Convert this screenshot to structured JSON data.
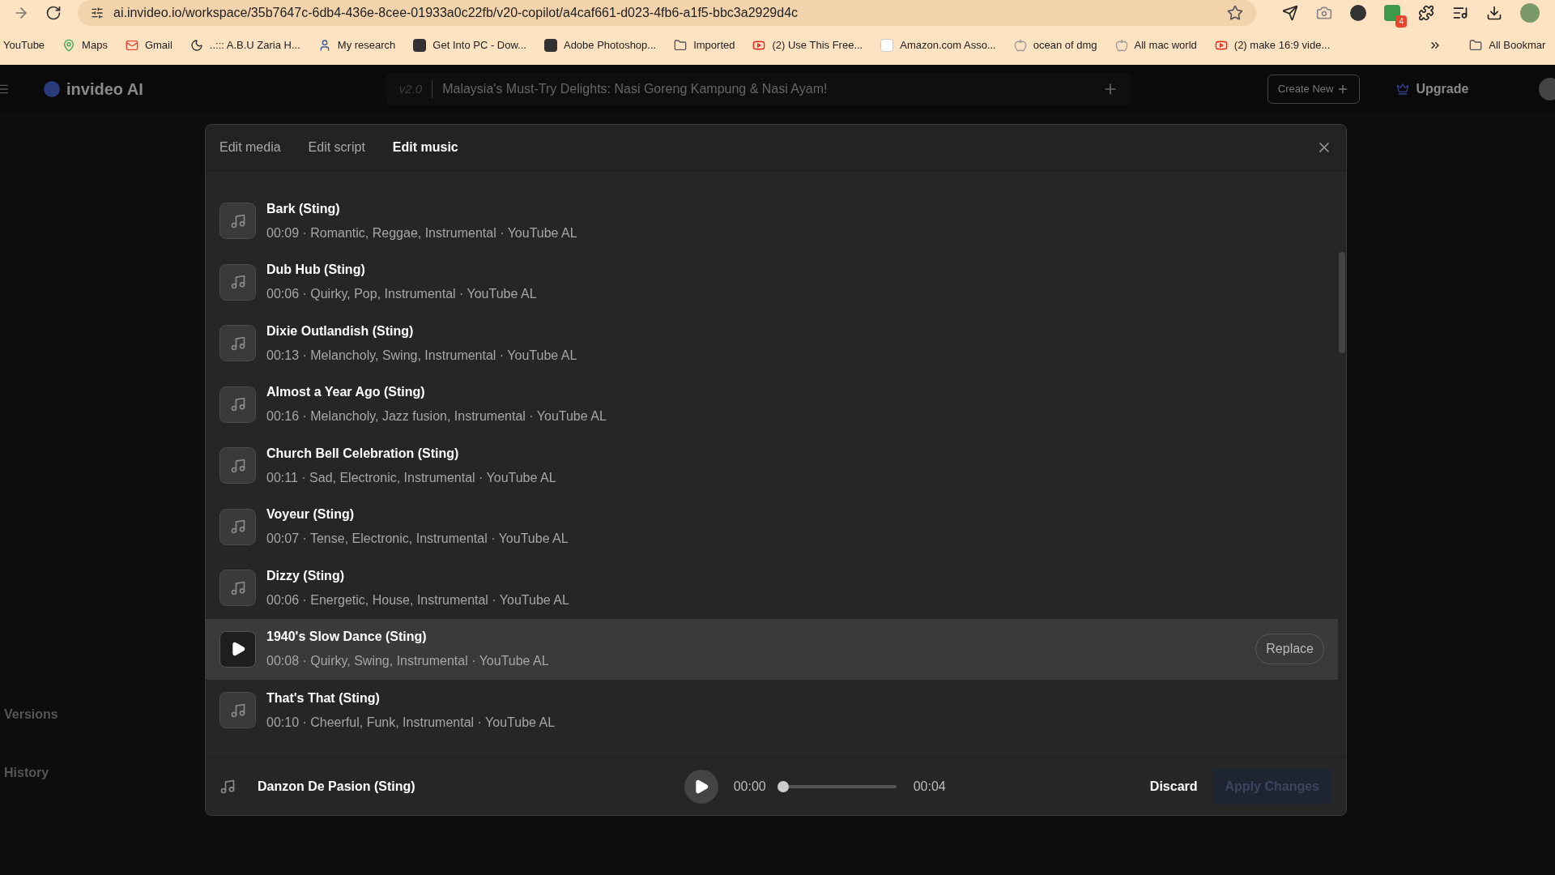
{
  "browser": {
    "url": "ai.invideo.io/workspace/35b7647c-6db4-436e-8cee-01933a0c22fb/v20-copilot/a4caf661-d023-4fb6-a1f5-bbc3a2929d4c",
    "extension_badge": "4",
    "bookmarks": [
      {
        "label": "YouTube",
        "kind": "none"
      },
      {
        "label": "Maps",
        "kind": "pin"
      },
      {
        "label": "Gmail",
        "kind": "mail"
      },
      {
        "label": "..::: A.B.U Zaria H...",
        "kind": "moon"
      },
      {
        "label": "My research",
        "kind": "person"
      },
      {
        "label": "Get Into PC - Dow...",
        "kind": "square"
      },
      {
        "label": "Adobe Photoshop...",
        "kind": "square"
      },
      {
        "label": "Imported",
        "kind": "folder"
      },
      {
        "label": "(2) Use This Free...",
        "kind": "video"
      },
      {
        "label": "Amazon.com Asso...",
        "kind": "letter"
      },
      {
        "label": "ocean of dmg",
        "kind": "apple"
      },
      {
        "label": "All mac world",
        "kind": "apple"
      },
      {
        "label": "(2) make 16:9 vide...",
        "kind": "video"
      }
    ],
    "all_bookmarks": "All Bookmar"
  },
  "app": {
    "logo": "invideo AI",
    "version": "v2.0",
    "project_title": "Malaysia's Must-Try Delights: Nasi Goreng Kampung & Nasi Ayam!",
    "create_new": "Create New",
    "upgrade": "Upgrade"
  },
  "sidebar": {
    "items": [
      "Versions",
      "History"
    ]
  },
  "dialog": {
    "tabs": [
      {
        "label": "Edit media",
        "selected": false
      },
      {
        "label": "Edit script",
        "selected": false
      },
      {
        "label": "Edit music",
        "selected": true
      }
    ],
    "tracks": [
      {
        "title": "Bark (Sting)",
        "meta": "00:09 · Romantic, Reggae, Instrumental · YouTube AL",
        "hovered": false
      },
      {
        "title": "Dub Hub (Sting)",
        "meta": "00:06 · Quirky, Pop, Instrumental · YouTube AL",
        "hovered": false
      },
      {
        "title": "Dixie Outlandish (Sting)",
        "meta": "00:13 · Melancholy, Swing, Instrumental · YouTube AL",
        "hovered": false
      },
      {
        "title": "Almost a Year Ago (Sting)",
        "meta": "00:16 · Melancholy, Jazz fusion, Instrumental · YouTube AL",
        "hovered": false
      },
      {
        "title": "Church Bell Celebration (Sting)",
        "meta": "00:11 · Sad, Electronic, Instrumental · YouTube AL",
        "hovered": false
      },
      {
        "title": "Voyeur (Sting)",
        "meta": "00:07 · Tense, Electronic, Instrumental · YouTube AL",
        "hovered": false
      },
      {
        "title": "Dizzy (Sting)",
        "meta": "00:06 · Energetic, House, Instrumental · YouTube AL",
        "hovered": false
      },
      {
        "title": "1940's Slow Dance (Sting)",
        "meta": "00:08 · Quirky, Swing, Instrumental · YouTube AL",
        "hovered": true
      },
      {
        "title": "That's That (Sting)",
        "meta": "00:10 · Cheerful, Funk, Instrumental · YouTube AL",
        "hovered": false
      }
    ],
    "replace": "Replace",
    "player": {
      "track": "Danzon De Pasion (Sting)",
      "current": "00:00",
      "duration": "00:04",
      "level": 0
    },
    "discard": "Discard",
    "apply": "Apply Changes",
    "apply_disabled": true
  }
}
